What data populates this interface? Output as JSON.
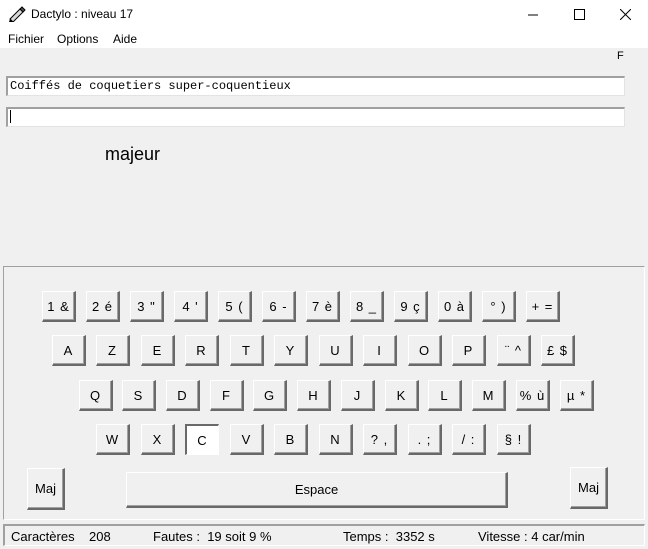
{
  "window": {
    "title": "Dactylo : niveau 17"
  },
  "menu": {
    "items": [
      "Fichier",
      "Options",
      "Aide"
    ]
  },
  "upper": {
    "flag": "F",
    "model_text": "Coiffés de coquetiers super-coquentieux",
    "typed_text": "",
    "finger": "majeur"
  },
  "keyboard": {
    "rows": [
      [
        "1 &",
        "2 é",
        "3 \"",
        "4 '",
        "5 (",
        "6 -",
        "7 è",
        "8 _",
        "9 ç",
        "0 à",
        "° )",
        "+ ="
      ],
      [
        "A",
        "Z",
        "E",
        "R",
        "T",
        "Y",
        "U",
        "I",
        "O",
        "P",
        "¨ ^",
        "£ $"
      ],
      [
        "Q",
        "S",
        "D",
        "F",
        "G",
        "H",
        "J",
        "K",
        "L",
        "M",
        "% ù",
        "µ *"
      ],
      [
        "W",
        "X",
        "C",
        "V",
        "B",
        "N",
        "? ,",
        ". ;",
        "/ :",
        "§ !"
      ]
    ],
    "highlighted_key": "C",
    "maj_left": "Maj",
    "space": "Espace",
    "maj_right": "Maj"
  },
  "status": {
    "chars": "Caractères    208",
    "errors": "Fautes :  19 soit 9 %",
    "time": "Temps :  3352 s",
    "speed": "Vitesse : 4 car/min"
  },
  "colors": {
    "background": "#f0f0f0",
    "field": "#ffffff",
    "key_shadow": "#696969"
  }
}
